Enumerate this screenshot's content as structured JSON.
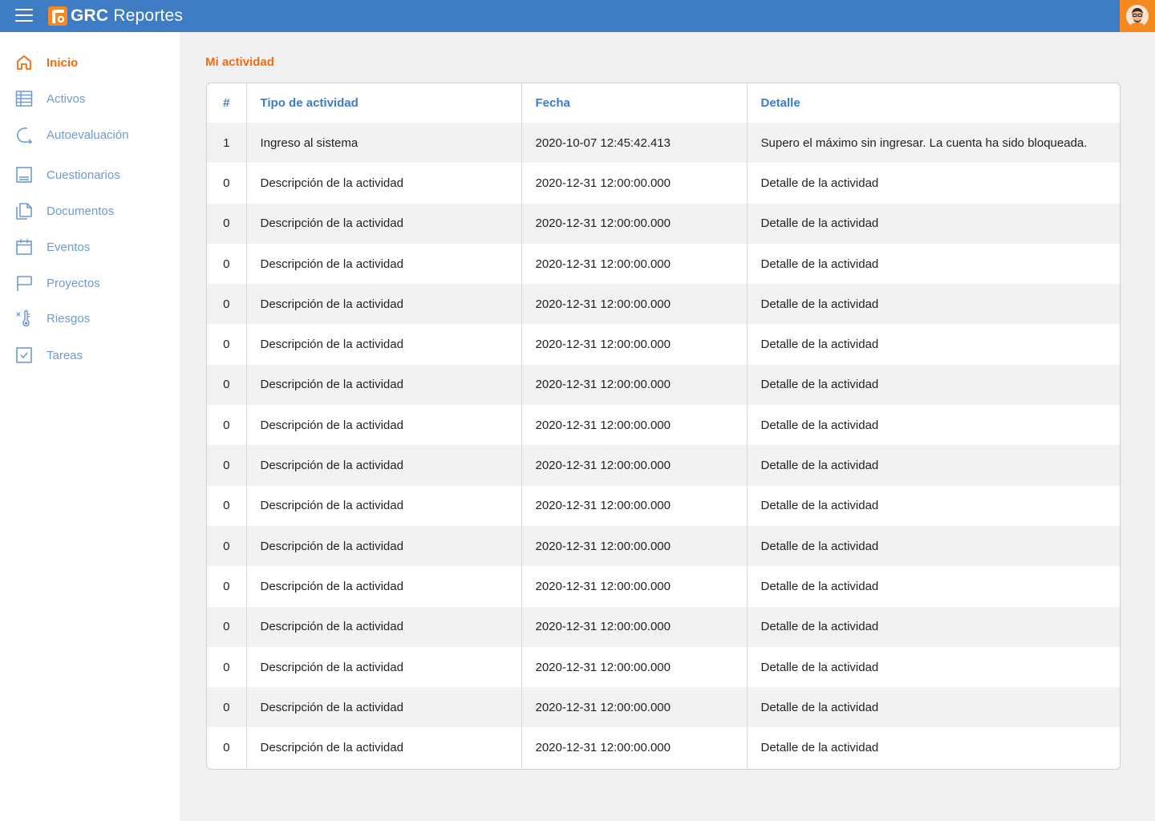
{
  "app": {
    "title_bold": "GRC",
    "title_rest": "Reportes",
    "accent_color": "#f26b0f",
    "brand_color": "#3e7cc4"
  },
  "sidebar": {
    "items": [
      {
        "label": "Inicio",
        "icon": "home-icon",
        "active": true
      },
      {
        "label": "Activos",
        "icon": "assets-list-icon"
      },
      {
        "label": "Autoevaluación",
        "icon": "self-assessment-icon"
      },
      {
        "label": "Cuestionarios",
        "icon": "questionnaire-icon"
      },
      {
        "label": "Documentos",
        "icon": "documents-icon"
      },
      {
        "label": "Eventos",
        "icon": "calendar-icon"
      },
      {
        "label": "Proyectos",
        "icon": "flag-icon"
      },
      {
        "label": "Riesgos",
        "icon": "thermometer-icon"
      },
      {
        "label": "Tareas",
        "icon": "checkbox-icon"
      }
    ]
  },
  "main": {
    "title": "Mi actividad",
    "table": {
      "headers": [
        "#",
        "Tipo de actividad",
        "Fecha",
        "Detalle"
      ],
      "rows": [
        [
          "1",
          "Ingreso al sistema",
          "2020-10-07 12:45:42.413",
          "Supero el máximo sin ingresar. La cuenta ha sido bloqueada."
        ],
        [
          "0",
          "Descripción de la actividad",
          "2020-12-31 12:00:00.000",
          "Detalle de la actividad"
        ],
        [
          "0",
          "Descripción de la actividad",
          "2020-12-31 12:00:00.000",
          "Detalle de la actividad"
        ],
        [
          "0",
          "Descripción de la actividad",
          "2020-12-31 12:00:00.000",
          "Detalle de la actividad"
        ],
        [
          "0",
          "Descripción de la actividad",
          "2020-12-31 12:00:00.000",
          "Detalle de la actividad"
        ],
        [
          "0",
          "Descripción de la actividad",
          "2020-12-31 12:00:00.000",
          "Detalle de la actividad"
        ],
        [
          "0",
          "Descripción de la actividad",
          "2020-12-31 12:00:00.000",
          "Detalle de la actividad"
        ],
        [
          "0",
          "Descripción de la actividad",
          "2020-12-31 12:00:00.000",
          "Detalle de la actividad"
        ],
        [
          "0",
          "Descripción de la actividad",
          "2020-12-31 12:00:00.000",
          "Detalle de la actividad"
        ],
        [
          "0",
          "Descripción de la actividad",
          "2020-12-31 12:00:00.000",
          "Detalle de la actividad"
        ],
        [
          "0",
          "Descripción de la actividad",
          "2020-12-31 12:00:00.000",
          "Detalle de la actividad"
        ],
        [
          "0",
          "Descripción de la actividad",
          "2020-12-31 12:00:00.000",
          "Detalle de la actividad"
        ],
        [
          "0",
          "Descripción de la actividad",
          "2020-12-31 12:00:00.000",
          "Detalle de la actividad"
        ],
        [
          "0",
          "Descripción de la actividad",
          "2020-12-31 12:00:00.000",
          "Detalle de la actividad"
        ],
        [
          "0",
          "Descripción de la actividad",
          "2020-12-31 12:00:00.000",
          "Detalle de la actividad"
        ],
        [
          "0",
          "Descripción de la actividad",
          "2020-12-31 12:00:00.000",
          "Detalle de la actividad"
        ]
      ]
    }
  }
}
